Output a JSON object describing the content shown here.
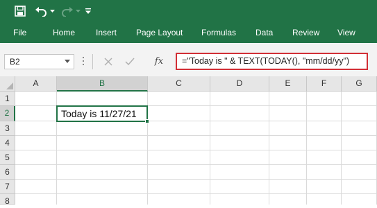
{
  "quick_access": {
    "save_icon": "save-icon",
    "undo_icon": "undo-icon",
    "redo_icon": "redo-icon",
    "customize_icon": "customize-qat-icon"
  },
  "ribbon": {
    "tabs": [
      "File",
      "Home",
      "Insert",
      "Page Layout",
      "Formulas",
      "Data",
      "Review",
      "View"
    ]
  },
  "formula_bar": {
    "name_box": "B2",
    "cancel_icon": "cancel-icon",
    "enter_icon": "enter-icon",
    "fx_label": "fx",
    "formula": "=\"Today is \" & TEXT(TODAY(), \"mm/dd/yy\")"
  },
  "sheet": {
    "columns": [
      "A",
      "B",
      "C",
      "D",
      "E",
      "F",
      "G"
    ],
    "rows": [
      "1",
      "2",
      "3",
      "4",
      "5",
      "6",
      "7",
      "8"
    ],
    "selected_column": "B",
    "selected_row": "2",
    "active_cell_value": "Today is 11/27/21"
  },
  "colors": {
    "accent": "#217346",
    "formula_highlight": "#d22f36"
  }
}
